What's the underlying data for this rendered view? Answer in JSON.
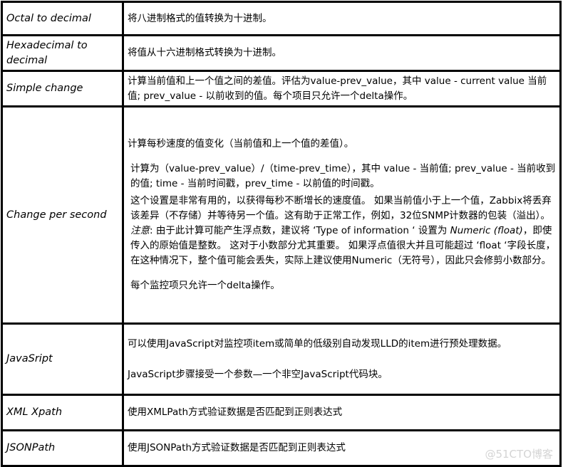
{
  "rows": [
    {
      "name": "Octal to decimal",
      "desc": "将八进制格式的值转换为十进制。"
    },
    {
      "name": "Hexadecimal to decimal",
      "desc": "将值从十六进制格式转换为十进制。"
    },
    {
      "name": "Simple change",
      "desc": "计算当前值和上一个值之间的差值。评估为value-prev_value，其中 value - current value 当前值; prev_value - 以前收到的值。每个项目只允许一个delta操作。"
    },
    {
      "name": "Change per second",
      "p1": "计算每秒速度的值变化（当前值和上一个值的差值）。",
      "p2": "计算为（value-prev_value）/（time-prev_time），其中 value - 当前值; prev_value - 当前收到的值; time - 当前时间戳，prev_time - 以前值的时间戳。",
      "p3": "这个设置是非常有用的，以获得每秒不断增长的速度值。 如果当前值小于上一个值，Zabbix将丢弃该差异（不存储）并等待另一个值。这有助于正常工作，例如，32位SNMP计数器的包装（溢出）。",
      "note_label": "注意",
      "note_a": ": 由于此计算可能产生浮点数，建议将 ‘Type  of information ‘ 设置为 ",
      "note_em": "Numeric (float)",
      "note_b": "，即使传入的原始值是整数。 这对于小数部分尤其重要。 如果浮点值很大并且可能超过 ‘float ‘字段长度，在这种情况下，整个值可能会丢失，实际上建议使用Numeric（无符号），因此只会修剪小数部分。",
      "p5": "每个监控项只允许一个delta操作。"
    },
    {
      "name": "JavaSript",
      "p1": "可以使用JavaScript对监控项item或简单的低级别自动发现LLD的item进行预处理数据。",
      "p2": "JavaScript步骤接受一个参数—一个非空JavaScript代码块。"
    },
    {
      "name": "XML Xpath",
      "desc": "使用XMLPath方式验证数据是否匹配到正则表达式"
    },
    {
      "name": "JSONPath",
      "desc": "使用JSONPath方式验证数据是否匹配到正则表达式"
    }
  ],
  "watermark": "@51CTO博客"
}
